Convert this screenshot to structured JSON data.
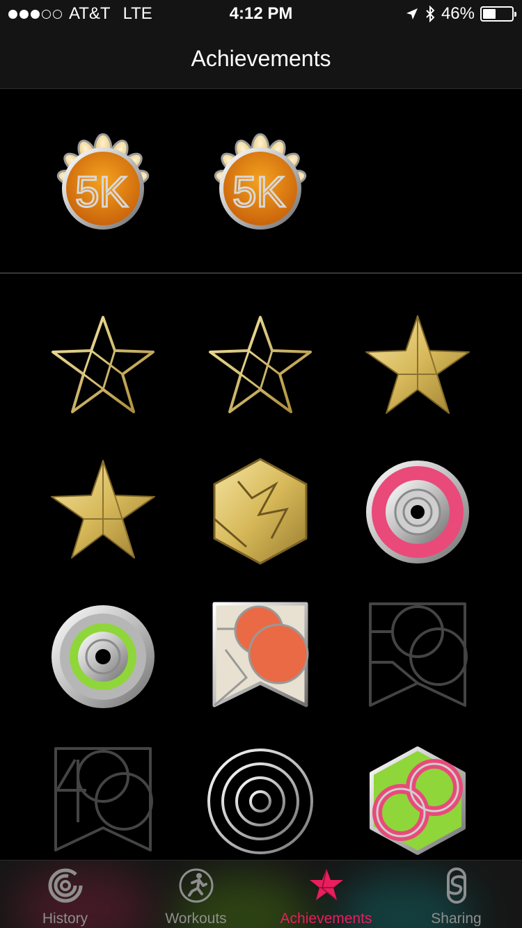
{
  "status": {
    "carrier": "AT&T",
    "network": "LTE",
    "time": "4:12 PM",
    "battery": "46%",
    "battery_level": 0.46,
    "signal_bars": 3,
    "signal_total": 5
  },
  "nav": {
    "title": "Achievements"
  },
  "featured_badges": [
    {
      "name": "5K",
      "text": "5K"
    },
    {
      "name": "5K",
      "text": "5K"
    }
  ],
  "badges": [
    "star-outline-gold",
    "star-outline-gold",
    "star-solid-gold",
    "star-solid-gold",
    "hexagon-gold",
    "ring-pink",
    "ring-green",
    "60-colored",
    "60-outline",
    "40-outline",
    "ring-outline",
    "infinity-green-pink"
  ],
  "tabs": [
    {
      "label": "History",
      "icon": "history-icon",
      "active": false
    },
    {
      "label": "Workouts",
      "icon": "workouts-icon",
      "active": false
    },
    {
      "label": "Achievements",
      "icon": "achievements-icon",
      "active": true
    },
    {
      "label": "Sharing",
      "icon": "sharing-icon",
      "active": false
    }
  ],
  "colors": {
    "accent": "#e91e5c",
    "gold": "#d9c06a",
    "orange": "#e8820c",
    "pink": "#e94a7a",
    "green": "#8fd63a"
  }
}
